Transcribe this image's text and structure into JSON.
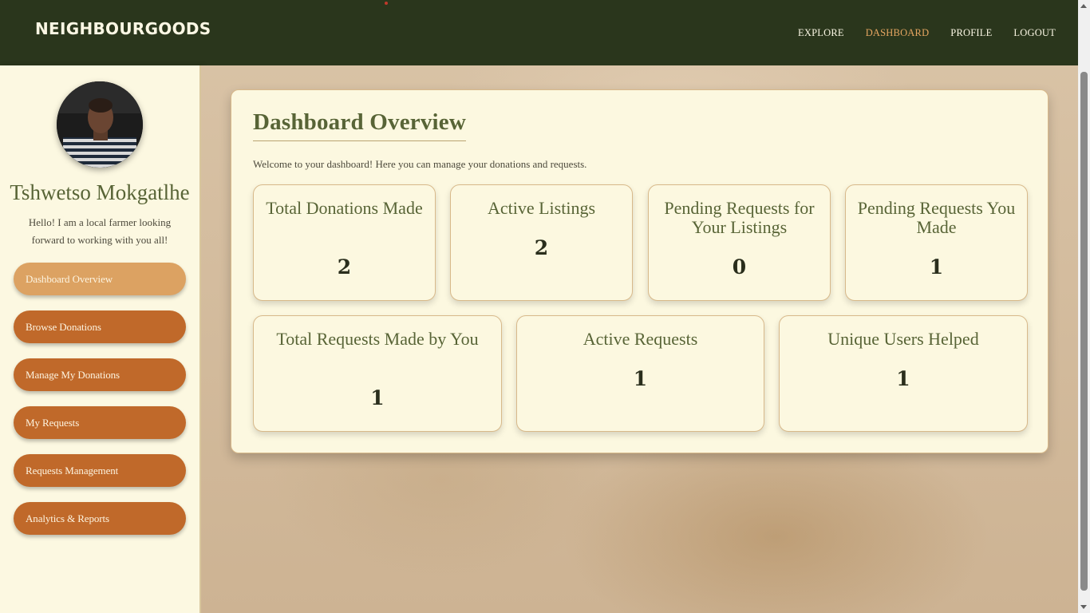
{
  "header": {
    "brand": "NEIGHBOURGOODS",
    "nav": [
      "EXPLORE",
      "DASHBOARD",
      "PROFILE",
      "LOGOUT"
    ],
    "active_nav": "DASHBOARD"
  },
  "sidebar": {
    "user_name": "Tshwetso Mokgatlhe",
    "bio": "Hello! I am a local farmer looking forward to working with you all!",
    "items": [
      {
        "label": "Dashboard Overview"
      },
      {
        "label": "Browse Donations"
      },
      {
        "label": "Manage My Donations"
      },
      {
        "label": "My Requests"
      },
      {
        "label": "Requests Management"
      },
      {
        "label": "Analytics & Reports"
      }
    ]
  },
  "main": {
    "title": "Dashboard Overview",
    "subtitle": "Welcome to your dashboard! Here you can manage your donations and requests.",
    "stats": [
      {
        "title": "Total Donations Made",
        "value": "2"
      },
      {
        "title": "Active Listings",
        "value": "2"
      },
      {
        "title": "Pending Requests for Your Listings",
        "value": "0"
      },
      {
        "title": "Pending Requests You Made",
        "value": "1"
      },
      {
        "title": "Total Requests Made by You",
        "value": "1"
      },
      {
        "title": "Active Requests",
        "value": "1"
      },
      {
        "title": "Unique Users Helped",
        "value": "1"
      }
    ]
  },
  "colors": {
    "header_bg": "#2a361c",
    "accent_active": "#e6a661",
    "menu_bg": "#c0692a",
    "menu_active_bg": "#dca262",
    "title_green": "#586436",
    "panel_bg": "#fcf8e0"
  }
}
